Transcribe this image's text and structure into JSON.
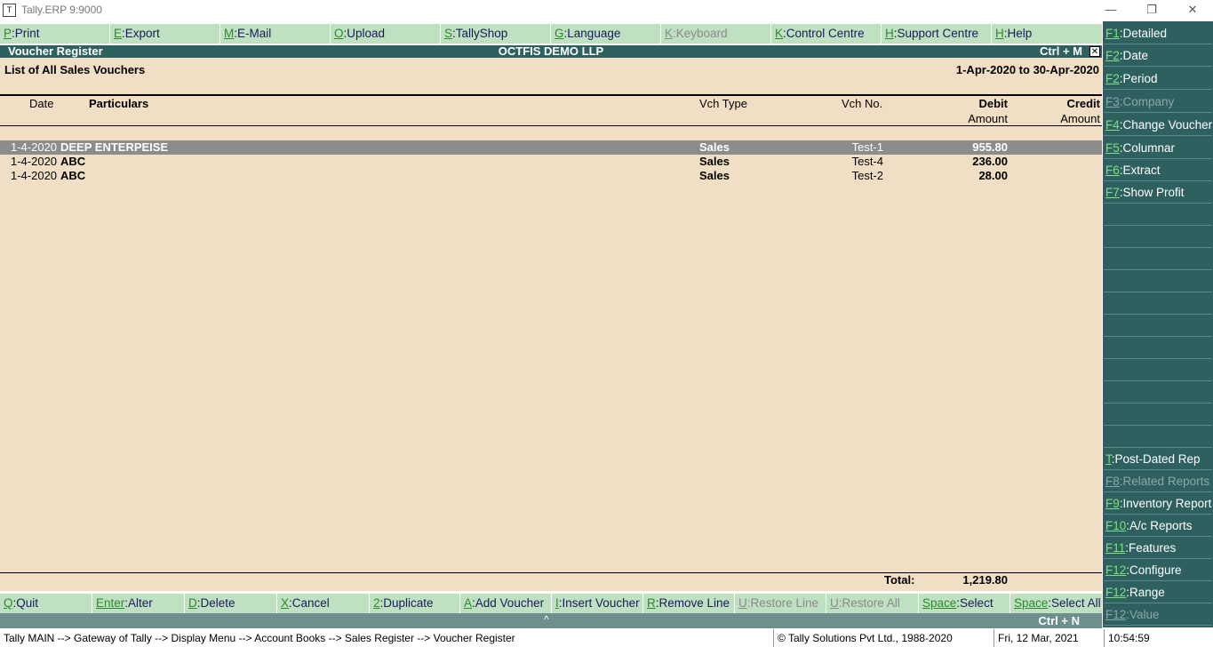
{
  "window": {
    "title": "Tally.ERP 9:9000",
    "minimize": "—",
    "restore": "❐",
    "close": "✕"
  },
  "top_buttons": [
    {
      "key": "P",
      "label": "Print",
      "disabled": false
    },
    {
      "key": "E",
      "label": "Export",
      "disabled": false
    },
    {
      "key": "M",
      "label": "E-Mail",
      "disabled": false
    },
    {
      "key": "O",
      "label": "Upload",
      "disabled": false
    },
    {
      "key": "S",
      "label": "TallyShop",
      "disabled": false
    },
    {
      "key": "G",
      "label": "Language",
      "disabled": false
    },
    {
      "key": "K",
      "label": "Keyboard",
      "disabled": true
    },
    {
      "key": "K",
      "label": "Control Centre",
      "disabled": false
    },
    {
      "key": "H",
      "label": "Support Centre",
      "disabled": false
    },
    {
      "key": "H",
      "label": "Help",
      "disabled": false
    }
  ],
  "report": {
    "title": "Voucher Register",
    "company": "OCTFIS DEMO LLP",
    "shortcut": "Ctrl + M",
    "close_glyph": "✕",
    "subtitle": "List of All Sales Vouchers",
    "period": "1-Apr-2020 to 30-Apr-2020"
  },
  "columns": {
    "date": "Date",
    "particulars": "Particulars",
    "vch_type": "Vch Type",
    "vch_no": "Vch No.",
    "debit": "Debit",
    "debit_sub": "Amount",
    "credit": "Credit",
    "credit_sub": "Amount"
  },
  "rows": [
    {
      "date": "1-4-2020",
      "particulars": "DEEP ENTERPEISE",
      "vch_type": "Sales",
      "vch_no": "Test-1",
      "debit": "955.80",
      "credit": ""
    },
    {
      "date": "1-4-2020",
      "particulars": "ABC",
      "vch_type": "Sales",
      "vch_no": "Test-4",
      "debit": "236.00",
      "credit": ""
    },
    {
      "date": "1-4-2020",
      "particulars": "ABC",
      "vch_type": "Sales",
      "vch_no": "Test-2",
      "debit": "28.00",
      "credit": ""
    }
  ],
  "total": {
    "label": "Total:",
    "debit": "1,219.80"
  },
  "bottom_buttons": [
    {
      "key": "Q",
      "label": "Quit",
      "disabled": false
    },
    {
      "key": "Enter",
      "label": "Alter",
      "disabled": false
    },
    {
      "key": "D",
      "label": "Delete",
      "disabled": false
    },
    {
      "key": "X",
      "label": "Cancel",
      "disabled": false
    },
    {
      "key": "2",
      "label": "Duplicate",
      "disabled": false
    },
    {
      "key": "A",
      "label": "Add Voucher",
      "disabled": false
    },
    {
      "key": "I",
      "label": "Insert Voucher",
      "disabled": false
    },
    {
      "key": "R",
      "label": "Remove Line",
      "disabled": false
    },
    {
      "key": "U",
      "label": "Restore Line",
      "disabled": true
    },
    {
      "key": "U",
      "label": "Restore All",
      "disabled": true
    },
    {
      "key": "Space",
      "label": "Select",
      "disabled": false
    },
    {
      "key": "Space",
      "label": "Select All",
      "disabled": false
    }
  ],
  "ctrl_bar": {
    "caret": "^",
    "shortcut": "Ctrl + N"
  },
  "side_buttons_top": [
    {
      "key": "F1",
      "label": "Detailed",
      "disabled": false
    },
    {
      "key": "F2",
      "label": "Date",
      "disabled": false
    },
    {
      "key": "F2",
      "label": "Period",
      "disabled": false
    },
    {
      "key": "F3",
      "label": "Company",
      "disabled": true
    },
    {
      "key": "F4",
      "label": "Change Voucher",
      "disabled": false
    },
    {
      "key": "F5",
      "label": "Columnar",
      "disabled": false
    },
    {
      "key": "F6",
      "label": "Extract",
      "disabled": false
    },
    {
      "key": "F7",
      "label": "Show Profit",
      "disabled": false
    }
  ],
  "side_buttons_bottom": [
    {
      "key": "T",
      "label": "Post-Dated Rep",
      "disabled": false
    },
    {
      "key": "F8",
      "label": "Related Reports",
      "disabled": true
    },
    {
      "key": "F9",
      "label": "Inventory Reports",
      "disabled": false
    },
    {
      "key": "F10",
      "label": "A/c Reports",
      "disabled": false
    },
    {
      "key": "F11",
      "label": "Features",
      "disabled": false
    },
    {
      "key": "F12",
      "label": "Configure",
      "disabled": false
    },
    {
      "key": "F12",
      "label": "Range",
      "disabled": false
    },
    {
      "key": "F12",
      "label": "Value",
      "disabled": true
    }
  ],
  "status": {
    "breadcrumb": "Tally MAIN --> Gateway of Tally --> Display Menu --> Account Books --> Sales Register --> Voucher Register",
    "copyright": "© Tally Solutions Pvt Ltd., 1988-2020",
    "date": "Fri, 12 Mar, 2021",
    "time": "10:54:59"
  }
}
